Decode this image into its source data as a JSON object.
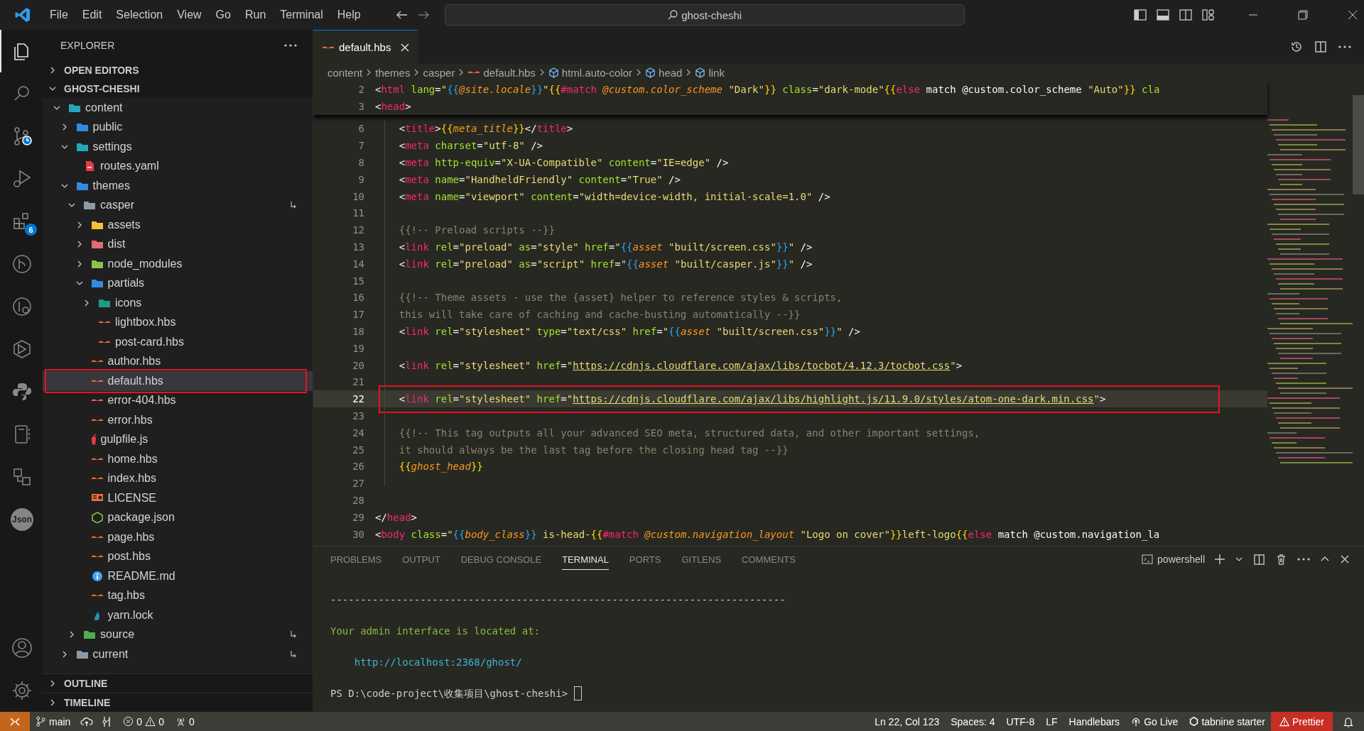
{
  "title_bar": {
    "menus": [
      "File",
      "Edit",
      "Selection",
      "View",
      "Go",
      "Run",
      "Terminal",
      "Help"
    ],
    "search": {
      "value": "ghost-cheshi"
    }
  },
  "activity_bar": {
    "items": [
      {
        "kind": "files",
        "selected": true
      },
      {
        "kind": "search",
        "selected": false
      },
      {
        "kind": "scm",
        "selected": false
      },
      {
        "kind": "debug",
        "selected": false
      },
      {
        "kind": "extensions",
        "selected": false,
        "badge": "6"
      },
      {
        "kind": "gitlens",
        "selected": false
      },
      {
        "kind": "inspect",
        "selected": false
      },
      {
        "kind": "hexagon",
        "selected": false
      },
      {
        "kind": "python",
        "selected": false
      },
      {
        "kind": "notebook",
        "selected": false
      },
      {
        "kind": "squares",
        "selected": false
      },
      {
        "kind": "json",
        "selected": false,
        "label": "Json"
      }
    ],
    "bottom": [
      {
        "kind": "account",
        "selected": false
      },
      {
        "kind": "settings",
        "selected": false
      }
    ]
  },
  "sidebar": {
    "title": "EXPLORER",
    "sections": [
      {
        "label": "OPEN EDITORS",
        "expanded": false
      },
      {
        "label": "GHOST-CHESHI",
        "expanded": true
      }
    ],
    "tree": [
      {
        "name": "content",
        "kind": "folder",
        "color": "#26a6bb",
        "expanded": true,
        "selected": false,
        "children": [
          {
            "name": "public",
            "kind": "folder",
            "color": "#2f8be0",
            "expanded": false,
            "selected": false
          },
          {
            "name": "settings",
            "kind": "folder",
            "color": "#26a6bb",
            "expanded": true,
            "selected": false,
            "children": [
              {
                "name": "routes.yaml",
                "kind": "yaml",
                "selected": false
              }
            ]
          },
          {
            "name": "themes",
            "kind": "folder",
            "color": "#2f8be0",
            "expanded": true,
            "selected": false,
            "children": [
              {
                "name": "casper",
                "kind": "folder",
                "color": "#8a9aa8",
                "expanded": true,
                "selected": false,
                "linked": true,
                "children": [
                  {
                    "name": "assets",
                    "kind": "folder",
                    "color": "#f4c13a",
                    "expanded": false,
                    "selected": false
                  },
                  {
                    "name": "dist",
                    "kind": "folder",
                    "color": "#e46b6f",
                    "expanded": false,
                    "selected": false
                  },
                  {
                    "name": "node_modules",
                    "kind": "folder",
                    "color": "#8bc34a",
                    "expanded": false,
                    "selected": false
                  },
                  {
                    "name": "partials",
                    "kind": "folder",
                    "color": "#2f8be0",
                    "expanded": true,
                    "selected": false,
                    "children": [
                      {
                        "name": "icons",
                        "kind": "folder",
                        "color": "#1e9b87",
                        "expanded": false,
                        "selected": false
                      },
                      {
                        "name": "lightbox.hbs",
                        "kind": "hbs",
                        "selected": false
                      },
                      {
                        "name": "post-card.hbs",
                        "kind": "hbs",
                        "selected": false
                      }
                    ]
                  },
                  {
                    "name": "author.hbs",
                    "kind": "hbs",
                    "selected": false
                  },
                  {
                    "name": "default.hbs",
                    "kind": "hbs",
                    "selected": true
                  },
                  {
                    "name": "error-404.hbs",
                    "kind": "hbs",
                    "selected": false
                  },
                  {
                    "name": "error.hbs",
                    "kind": "hbs",
                    "selected": false
                  },
                  {
                    "name": "gulpfile.js",
                    "kind": "gulp",
                    "selected": false
                  },
                  {
                    "name": "home.hbs",
                    "kind": "hbs",
                    "selected": false
                  },
                  {
                    "name": "index.hbs",
                    "kind": "hbs",
                    "selected": false
                  },
                  {
                    "name": "LICENSE",
                    "kind": "license",
                    "selected": false
                  },
                  {
                    "name": "package.json",
                    "kind": "npm",
                    "selected": false
                  },
                  {
                    "name": "page.hbs",
                    "kind": "hbs",
                    "selected": false
                  },
                  {
                    "name": "post.hbs",
                    "kind": "hbs",
                    "selected": false
                  },
                  {
                    "name": "README.md",
                    "kind": "info",
                    "selected": false
                  },
                  {
                    "name": "tag.hbs",
                    "kind": "hbs",
                    "selected": false
                  },
                  {
                    "name": "yarn.lock",
                    "kind": "yarn",
                    "selected": false
                  }
                ]
              },
              {
                "name": "source",
                "kind": "folder",
                "color": "#4caf50",
                "expanded": false,
                "selected": false,
                "linked": true
              }
            ]
          },
          {
            "name": "current",
            "kind": "folder",
            "color": "#8a9aa8",
            "expanded": false,
            "selected": false,
            "linked": true
          }
        ]
      }
    ],
    "footer_sections": [
      {
        "label": "OUTLINE",
        "expanded": false
      },
      {
        "label": "TIMELINE",
        "expanded": false
      }
    ]
  },
  "editor": {
    "tabs": [
      {
        "label": "default.hbs",
        "selected": true
      }
    ],
    "breadcrumbs": [
      {
        "label": "content",
        "kind": "folder"
      },
      {
        "label": "themes",
        "kind": "folder"
      },
      {
        "label": "casper",
        "kind": "folder"
      },
      {
        "label": "default.hbs",
        "kind": "hbs"
      },
      {
        "label": "html.auto-color",
        "kind": "symbol"
      },
      {
        "label": "head",
        "kind": "symbol"
      },
      {
        "label": "link",
        "kind": "symbol"
      }
    ],
    "sticky_lines": [
      {
        "number": "2",
        "tokens": [
          {
            "kind": "punct",
            "text": "<"
          },
          {
            "kind": "tag",
            "text": "html"
          },
          {
            "kind": "attr",
            "text": " lang"
          },
          {
            "kind": "punct",
            "text": "="
          },
          {
            "kind": "str",
            "text": "\""
          },
          {
            "kind": "b2",
            "text": "{{"
          },
          {
            "kind": "helper",
            "text": "@site.locale"
          },
          {
            "kind": "b2",
            "text": "}}"
          },
          {
            "kind": "str",
            "text": "\""
          },
          {
            "kind": "b1",
            "text": "{{"
          },
          {
            "kind": "kw",
            "text": "#match"
          },
          {
            "kind": "helper",
            "text": " @custom.color_scheme"
          },
          {
            "kind": "str",
            "text": " \"Dark\""
          },
          {
            "kind": "b1",
            "text": "}}"
          },
          {
            "kind": "attr",
            "text": " class"
          },
          {
            "kind": "punct",
            "text": "="
          },
          {
            "kind": "str",
            "text": "\"dark-mode\""
          },
          {
            "kind": "b1",
            "text": "{{"
          },
          {
            "kind": "kw",
            "text": "else"
          },
          {
            "kind": "punct",
            "text": " match @custom.color_scheme "
          },
          {
            "kind": "str",
            "text": "\"Auto\""
          },
          {
            "kind": "b1",
            "text": "}}"
          },
          {
            "kind": "attr",
            "text": " cla"
          }
        ]
      },
      {
        "number": "3",
        "tokens": [
          {
            "kind": "punct",
            "text": "<"
          },
          {
            "kind": "tag",
            "text": "head"
          },
          {
            "kind": "punct",
            "text": ">"
          }
        ]
      }
    ],
    "lines": [
      {
        "number": "6",
        "current": false,
        "tokens": [
          {
            "kind": "punct",
            "text": "    <"
          },
          {
            "kind": "tag",
            "text": "title"
          },
          {
            "kind": "punct",
            "text": ">"
          },
          {
            "kind": "b1",
            "text": "{{"
          },
          {
            "kind": "helper",
            "text": "meta_title"
          },
          {
            "kind": "b1",
            "text": "}}"
          },
          {
            "kind": "punct",
            "text": "</"
          },
          {
            "kind": "tag",
            "text": "title"
          },
          {
            "kind": "punct",
            "text": ">"
          }
        ]
      },
      {
        "number": "7",
        "current": false,
        "tokens": [
          {
            "kind": "punct",
            "text": "    <"
          },
          {
            "kind": "tag",
            "text": "meta"
          },
          {
            "kind": "attr",
            "text": " charset"
          },
          {
            "kind": "punct",
            "text": "="
          },
          {
            "kind": "str",
            "text": "\"utf-8\""
          },
          {
            "kind": "punct",
            "text": " />"
          }
        ]
      },
      {
        "number": "8",
        "current": false,
        "tokens": [
          {
            "kind": "punct",
            "text": "    <"
          },
          {
            "kind": "tag",
            "text": "meta"
          },
          {
            "kind": "attr",
            "text": " http-equiv"
          },
          {
            "kind": "punct",
            "text": "="
          },
          {
            "kind": "str",
            "text": "\"X-UA-Compatible\""
          },
          {
            "kind": "attr",
            "text": " content"
          },
          {
            "kind": "punct",
            "text": "="
          },
          {
            "kind": "str",
            "text": "\"IE=edge\""
          },
          {
            "kind": "punct",
            "text": " />"
          }
        ]
      },
      {
        "number": "9",
        "current": false,
        "tokens": [
          {
            "kind": "punct",
            "text": "    <"
          },
          {
            "kind": "tag",
            "text": "meta"
          },
          {
            "kind": "attr",
            "text": " name"
          },
          {
            "kind": "punct",
            "text": "="
          },
          {
            "kind": "str",
            "text": "\"HandheldFriendly\""
          },
          {
            "kind": "attr",
            "text": " content"
          },
          {
            "kind": "punct",
            "text": "="
          },
          {
            "kind": "str",
            "text": "\"True\""
          },
          {
            "kind": "punct",
            "text": " />"
          }
        ]
      },
      {
        "number": "10",
        "current": false,
        "tokens": [
          {
            "kind": "punct",
            "text": "    <"
          },
          {
            "kind": "tag",
            "text": "meta"
          },
          {
            "kind": "attr",
            "text": " name"
          },
          {
            "kind": "punct",
            "text": "="
          },
          {
            "kind": "str",
            "text": "\"viewport\""
          },
          {
            "kind": "attr",
            "text": " content"
          },
          {
            "kind": "punct",
            "text": "="
          },
          {
            "kind": "str",
            "text": "\"width=device-width, initial-scale=1.0\""
          },
          {
            "kind": "punct",
            "text": " />"
          }
        ]
      },
      {
        "number": "11",
        "current": false
      },
      {
        "number": "12",
        "current": false,
        "tokens": [
          {
            "kind": "comment",
            "text": "    {{!-- Preload scripts --}}"
          }
        ]
      },
      {
        "number": "13",
        "current": false,
        "tokens": [
          {
            "kind": "punct",
            "text": "    <"
          },
          {
            "kind": "tag",
            "text": "link"
          },
          {
            "kind": "attr",
            "text": " rel"
          },
          {
            "kind": "punct",
            "text": "="
          },
          {
            "kind": "str",
            "text": "\"preload\""
          },
          {
            "kind": "attr",
            "text": " as"
          },
          {
            "kind": "punct",
            "text": "="
          },
          {
            "kind": "str",
            "text": "\"style\""
          },
          {
            "kind": "attr",
            "text": " href"
          },
          {
            "kind": "punct",
            "text": "="
          },
          {
            "kind": "str",
            "text": "\""
          },
          {
            "kind": "b2",
            "text": "{{"
          },
          {
            "kind": "helper",
            "text": "asset"
          },
          {
            "kind": "str",
            "text": " \"built/screen.css\""
          },
          {
            "kind": "b2",
            "text": "}}"
          },
          {
            "kind": "str",
            "text": "\""
          },
          {
            "kind": "punct",
            "text": " />"
          }
        ]
      },
      {
        "number": "14",
        "current": false,
        "tokens": [
          {
            "kind": "punct",
            "text": "    <"
          },
          {
            "kind": "tag",
            "text": "link"
          },
          {
            "kind": "attr",
            "text": " rel"
          },
          {
            "kind": "punct",
            "text": "="
          },
          {
            "kind": "str",
            "text": "\"preload\""
          },
          {
            "kind": "attr",
            "text": " as"
          },
          {
            "kind": "punct",
            "text": "="
          },
          {
            "kind": "str",
            "text": "\"script\""
          },
          {
            "kind": "attr",
            "text": " href"
          },
          {
            "kind": "punct",
            "text": "="
          },
          {
            "kind": "str",
            "text": "\""
          },
          {
            "kind": "b2",
            "text": "{{"
          },
          {
            "kind": "helper",
            "text": "asset"
          },
          {
            "kind": "str",
            "text": " \"built/casper.js\""
          },
          {
            "kind": "b2",
            "text": "}}"
          },
          {
            "kind": "str",
            "text": "\""
          },
          {
            "kind": "punct",
            "text": " />"
          }
        ]
      },
      {
        "number": "15",
        "current": false
      },
      {
        "number": "16",
        "current": false,
        "tokens": [
          {
            "kind": "comment",
            "text": "    {{!-- Theme assets - use the {asset} helper to reference styles & scripts,"
          }
        ]
      },
      {
        "number": "17",
        "current": false,
        "tokens": [
          {
            "kind": "comment",
            "text": "    this will take care of caching and cache-busting automatically --}}"
          }
        ]
      },
      {
        "number": "18",
        "current": false,
        "tokens": [
          {
            "kind": "punct",
            "text": "    <"
          },
          {
            "kind": "tag",
            "text": "link"
          },
          {
            "kind": "attr",
            "text": " rel"
          },
          {
            "kind": "punct",
            "text": "="
          },
          {
            "kind": "str",
            "text": "\"stylesheet\""
          },
          {
            "kind": "attr",
            "text": " type"
          },
          {
            "kind": "punct",
            "text": "="
          },
          {
            "kind": "str",
            "text": "\"text/css\""
          },
          {
            "kind": "attr",
            "text": " href"
          },
          {
            "kind": "punct",
            "text": "="
          },
          {
            "kind": "str",
            "text": "\""
          },
          {
            "kind": "b2",
            "text": "{{"
          },
          {
            "kind": "helper",
            "text": "asset"
          },
          {
            "kind": "str",
            "text": " \"built/screen.css\""
          },
          {
            "kind": "b2",
            "text": "}}"
          },
          {
            "kind": "str",
            "text": "\""
          },
          {
            "kind": "punct",
            "text": " />"
          }
        ]
      },
      {
        "number": "19",
        "current": false
      },
      {
        "number": "20",
        "current": false,
        "tokens": [
          {
            "kind": "punct",
            "text": "    <"
          },
          {
            "kind": "tag",
            "text": "link"
          },
          {
            "kind": "attr",
            "text": " rel"
          },
          {
            "kind": "punct",
            "text": "="
          },
          {
            "kind": "str",
            "text": "\"stylesheet\""
          },
          {
            "kind": "attr",
            "text": " href"
          },
          {
            "kind": "punct",
            "text": "="
          },
          {
            "kind": "str",
            "text": "\""
          },
          {
            "kind": "url",
            "text": "https://cdnjs.cloudflare.com/ajax/libs/tocbot/4.12.3/tocbot.css"
          },
          {
            "kind": "str",
            "text": "\""
          },
          {
            "kind": "punct",
            "text": ">"
          }
        ]
      },
      {
        "number": "21",
        "current": false
      },
      {
        "number": "22",
        "current": true,
        "tokens": [
          {
            "kind": "punct",
            "text": "    <"
          },
          {
            "kind": "tag",
            "text": "link"
          },
          {
            "kind": "attr",
            "text": " rel"
          },
          {
            "kind": "punct",
            "text": "="
          },
          {
            "kind": "str",
            "text": "\"stylesheet\""
          },
          {
            "kind": "attr",
            "text": " href"
          },
          {
            "kind": "punct",
            "text": "="
          },
          {
            "kind": "str",
            "text": "\""
          },
          {
            "kind": "url",
            "text": "https://cdnjs.cloudflare.com/ajax/libs/highlight.js/11.9.0/styles/atom-one-dark.min.css"
          },
          {
            "kind": "str",
            "text": "\""
          },
          {
            "kind": "punct",
            "text": ">"
          }
        ]
      },
      {
        "number": "23",
        "current": false
      },
      {
        "number": "24",
        "current": false,
        "tokens": [
          {
            "kind": "comment",
            "text": "    {{!-- This tag outputs all your advanced SEO meta, structured data, and other important settings,"
          }
        ]
      },
      {
        "number": "25",
        "current": false,
        "tokens": [
          {
            "kind": "comment",
            "text": "    it should always be the last tag before the closing head tag --}}"
          }
        ]
      },
      {
        "number": "26",
        "current": false,
        "tokens": [
          {
            "kind": "b1",
            "text": "    {{"
          },
          {
            "kind": "helper",
            "text": "ghost_head"
          },
          {
            "kind": "b1",
            "text": "}}"
          }
        ]
      },
      {
        "number": "27",
        "current": false
      },
      {
        "number": "28",
        "current": false
      },
      {
        "number": "29",
        "current": false,
        "tokens": [
          {
            "kind": "punct",
            "text": "</"
          },
          {
            "kind": "tag",
            "text": "head"
          },
          {
            "kind": "punct",
            "text": ">"
          }
        ]
      },
      {
        "number": "30",
        "current": false,
        "tokens": [
          {
            "kind": "punct",
            "text": "<"
          },
          {
            "kind": "tag",
            "text": "body"
          },
          {
            "kind": "attr",
            "text": " class"
          },
          {
            "kind": "punct",
            "text": "="
          },
          {
            "kind": "str",
            "text": "\""
          },
          {
            "kind": "b2",
            "text": "{{"
          },
          {
            "kind": "helper",
            "text": "body_class"
          },
          {
            "kind": "b2",
            "text": "}}"
          },
          {
            "kind": "str",
            "text": " is-head-"
          },
          {
            "kind": "b1",
            "text": "{{"
          },
          {
            "kind": "kw",
            "text": "#match"
          },
          {
            "kind": "helper",
            "text": " @custom.navigation_layout"
          },
          {
            "kind": "str",
            "text": " \"Logo on cover\""
          },
          {
            "kind": "b1",
            "text": "}}"
          },
          {
            "kind": "str",
            "text": "left-logo"
          },
          {
            "kind": "b1",
            "text": "{{"
          },
          {
            "kind": "kw",
            "text": "else"
          },
          {
            "kind": "punct",
            "text": " match @custom.navigation_la"
          }
        ]
      }
    ]
  },
  "panel": {
    "tabs": [
      {
        "label": "PROBLEMS",
        "selected": false
      },
      {
        "label": "OUTPUT",
        "selected": false
      },
      {
        "label": "DEBUG CONSOLE",
        "selected": false
      },
      {
        "label": "TERMINAL",
        "selected": true
      },
      {
        "label": "PORTS",
        "selected": false
      },
      {
        "label": "GITLENS",
        "selected": false
      },
      {
        "label": "COMMENTS",
        "selected": false
      }
    ],
    "shell": "powershell",
    "terminal_lines": [
      {
        "kind": "plain",
        "text": "----------------------------------------------------------------------------"
      },
      {
        "kind": "success",
        "text": "Your admin interface is located at:"
      },
      {
        "kind": "link",
        "text": "    http://localhost:2368/ghost/"
      },
      {
        "kind": "prompt",
        "text": "PS D:\\code-project\\收集项目\\ghost-cheshi> "
      }
    ]
  },
  "status_bar": {
    "branch": "main",
    "errors": "0",
    "warnings": "0",
    "ports": "0",
    "right": [
      {
        "kind": "text",
        "text": "Ln 22, Col 123"
      },
      {
        "kind": "text",
        "text": "Spaces: 4"
      },
      {
        "kind": "text",
        "text": "UTF-8"
      },
      {
        "kind": "text",
        "text": "LF"
      },
      {
        "kind": "text",
        "text": "Handlebars"
      },
      {
        "kind": "golive",
        "text": "Go Live"
      },
      {
        "kind": "tabnine",
        "text": "tabnine starter"
      },
      {
        "kind": "warning",
        "text": "Prettier"
      }
    ]
  }
}
